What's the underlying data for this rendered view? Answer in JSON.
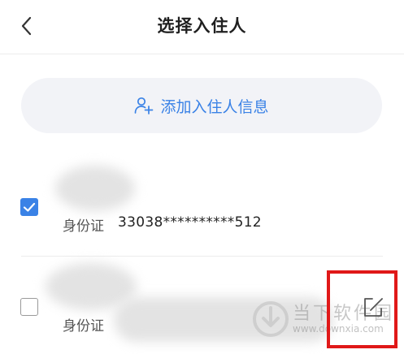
{
  "header": {
    "title": "选择入住人",
    "back_icon": "chevron-left-icon"
  },
  "add_guest": {
    "label": "添加入住人信息",
    "icon": "add-user-icon",
    "color": "#3a82e6"
  },
  "guests": [
    {
      "checked": true,
      "id_type": "身份证",
      "id_number": "33038**********512"
    },
    {
      "checked": false,
      "id_type": "身份证",
      "id_number": ""
    }
  ],
  "edit_icon": "edit-icon",
  "watermark": {
    "text": "当下软件园",
    "url": "www.downxia.com"
  },
  "colors": {
    "accent": "#3a82e6",
    "highlight": "#e01818"
  }
}
